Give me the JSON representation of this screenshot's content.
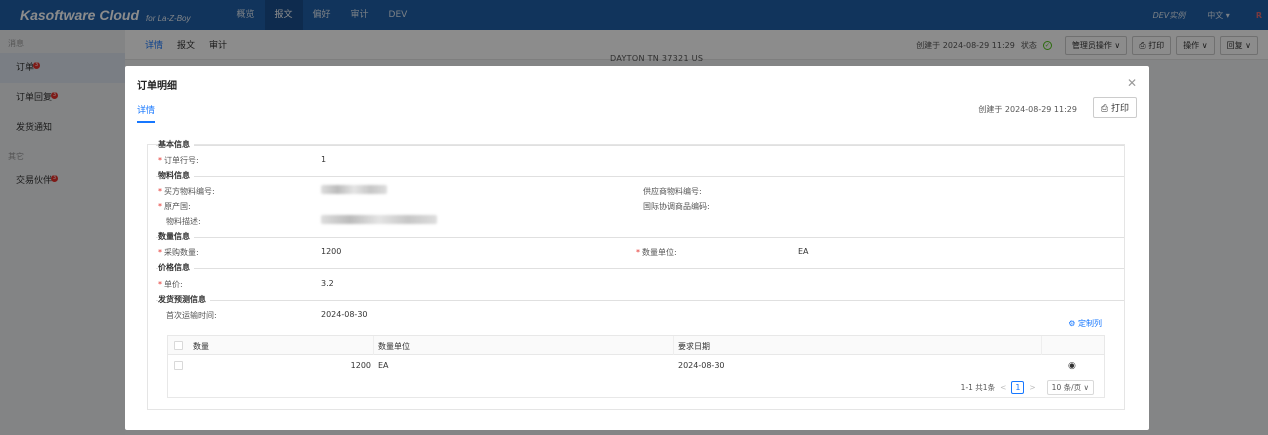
{
  "topbar": {
    "brand": "Kasoftware Cloud",
    "brand_sub": "for La-Z-Boy",
    "nav": [
      "概览",
      "报文",
      "偏好",
      "审计",
      "DEV"
    ],
    "env": "DEV实例",
    "lang": "中文 ▾",
    "user_initial": "R"
  },
  "sidebar": {
    "section_messages": "消息",
    "items": [
      {
        "label": "订单",
        "badge": "3"
      },
      {
        "label": "订单回复",
        "badge": "3"
      },
      {
        "label": "发货通知",
        "badge": ""
      }
    ],
    "section_other": "其它",
    "other_items": [
      {
        "label": "交易伙伴",
        "badge": "3"
      }
    ]
  },
  "bg_header": {
    "tabs": [
      "详情",
      "报文",
      "审计"
    ],
    "created": "创建于 2024-08-29 11:29",
    "status_label": "状态",
    "admin_ops": "管理员操作 ∨",
    "print": "打印",
    "ops": "操作 ∨",
    "reply": "回复 ∨",
    "address": "DAYTON TN 37321 US"
  },
  "modal": {
    "title": "订单明细",
    "tab": "详情",
    "created": "创建于 2024-08-29 11:29",
    "print": "打印",
    "sections": {
      "basic": "基本信息",
      "material": "物料信息",
      "quantity": "数量信息",
      "price": "价格信息",
      "shipping": "发货预测信息"
    },
    "fields": {
      "line_no_label": "订单行号:",
      "line_no_value": "1",
      "buyer_part_label": "买方物料编号:",
      "supplier_part_label": "供应商物料编号:",
      "origin_label": "原产国:",
      "hs_code_label": "国际协调商品编码:",
      "desc_label": "物料描述:",
      "qty_label": "采购数量:",
      "qty_value": "1200",
      "uom_label": "数量单位:",
      "uom_value": "EA",
      "price_label": "单价:",
      "price_value": "3.2",
      "first_ship_label": "首次运输时间:",
      "first_ship_value": "2024-08-30"
    },
    "customize": "定制列",
    "table": {
      "headers": [
        "数量",
        "数量单位",
        "要求日期"
      ],
      "rows": [
        {
          "qty": "1200",
          "uom": "EA",
          "date": "2024-08-30"
        }
      ]
    },
    "pager": {
      "summary": "1-1 共1条",
      "page": "1",
      "size": "10 条/页 ∨"
    }
  }
}
